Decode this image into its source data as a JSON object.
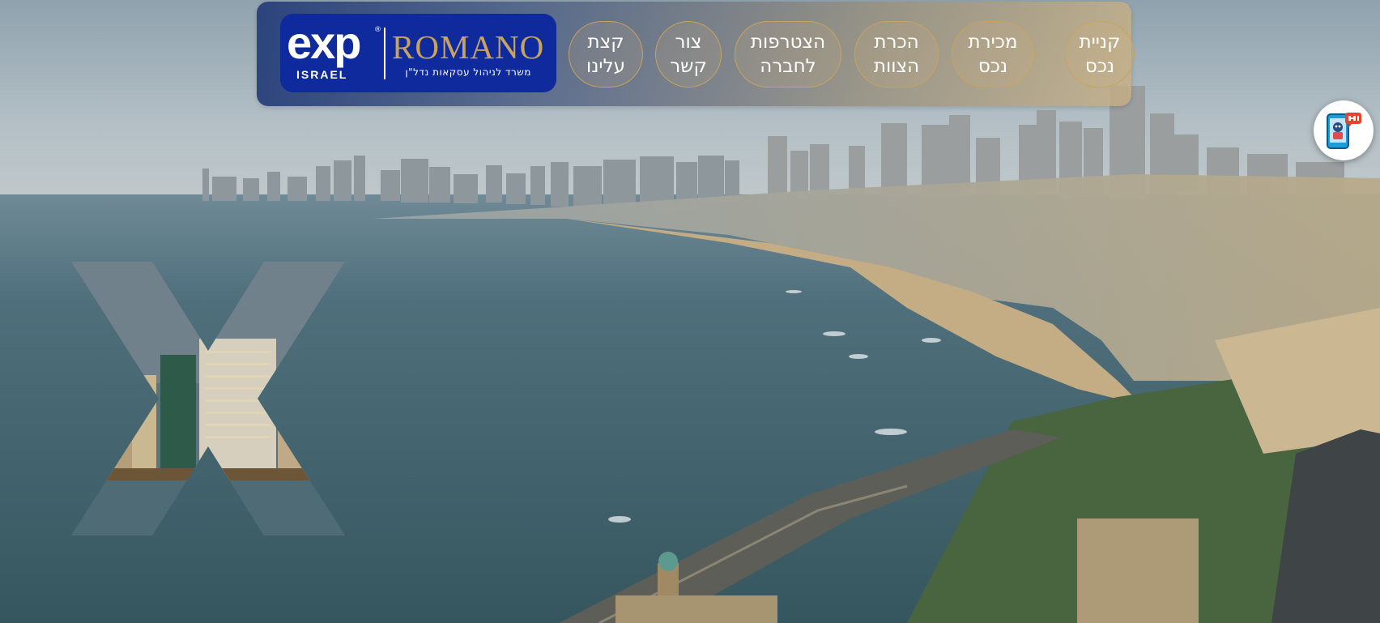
{
  "brand": {
    "exp_text": "exp",
    "registered_mark": "®",
    "country": "ISRAEL",
    "name": "ROMANO",
    "tagline": "משרד לניהול עסקאות נדל\"ן"
  },
  "nav": {
    "items": [
      {
        "label": "קניית\nנכס"
      },
      {
        "label": "מכירת\nנכס"
      },
      {
        "label": "הכרת\nהצוות"
      },
      {
        "label": "הצטרפות\nלחברה"
      },
      {
        "label": "צור\nקשר"
      },
      {
        "label": "קצת\nעלינו"
      }
    ]
  },
  "colors": {
    "logo_bg": "#0f2a9c",
    "accent_gold": "#c9a35d",
    "sea": "#3c6472",
    "sky": "#aebcc4"
  },
  "icons": {
    "chat": "chatbot-icon",
    "overlay": "x-mark-icon"
  }
}
